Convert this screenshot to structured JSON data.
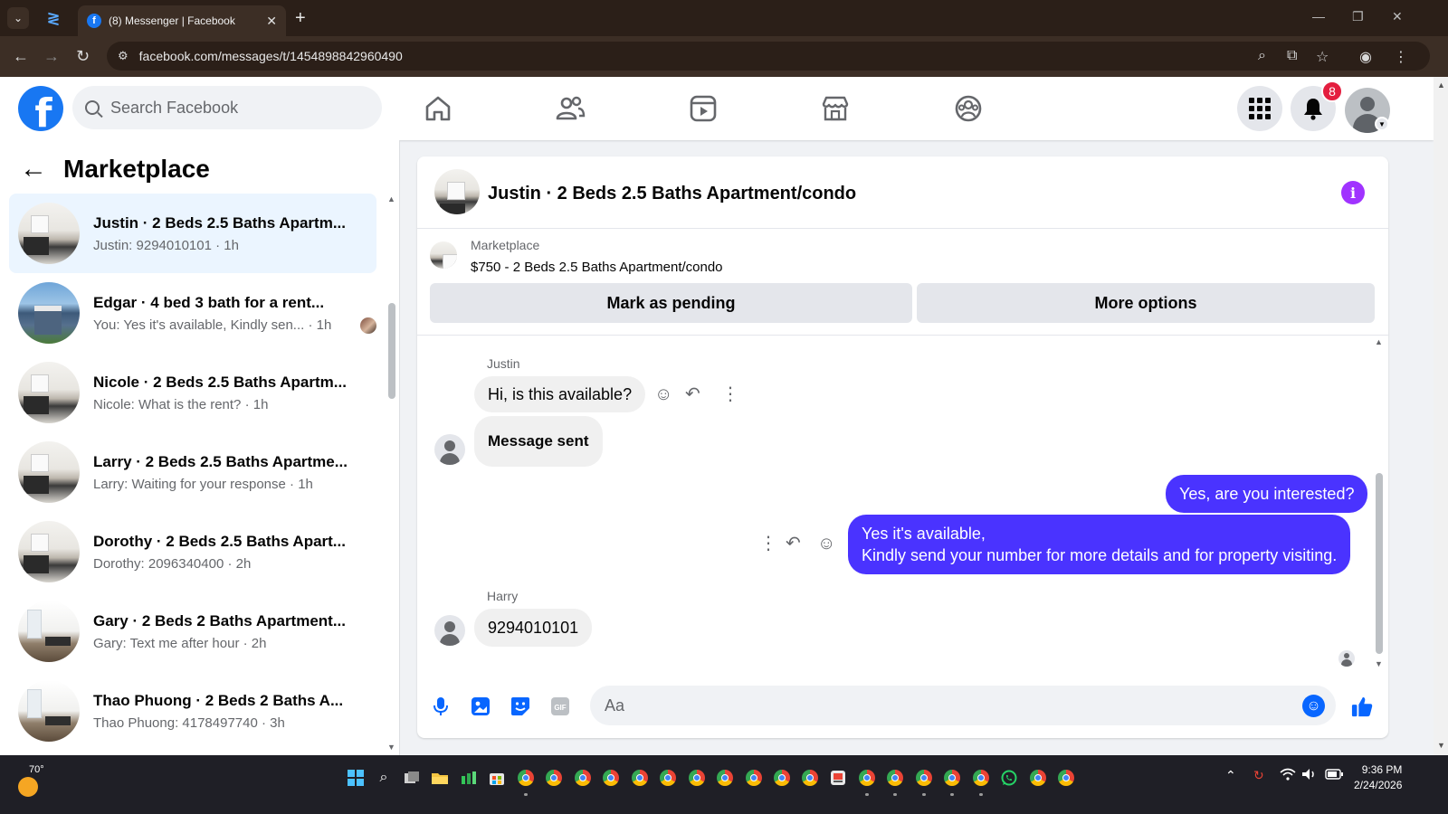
{
  "browser": {
    "tab_title": "(8) Messenger | Facebook",
    "url": "facebook.com/messages/t/1454898842960490"
  },
  "fb": {
    "search_placeholder": "Search Facebook",
    "notifications_count": "8"
  },
  "marketplace": {
    "title": "Marketplace",
    "conversations": [
      {
        "name": "Justin · 2 Beds 2.5 Baths Apartm...",
        "preview": "Justin: 9294010101 · 1h",
        "thumb": "room",
        "active": true
      },
      {
        "name": "Edgar · 4 bed 3 bath for a rent...",
        "preview": "You: Yes it's available, Kindly sen... · 1h",
        "thumb": "house",
        "active": false
      },
      {
        "name": "Nicole · 2 Beds 2.5 Baths Apartm...",
        "preview": "Nicole: What is the rent? · 1h",
        "thumb": "room",
        "active": false
      },
      {
        "name": "Larry · 2 Beds 2.5 Baths Apartme...",
        "preview": "Larry: Waiting for your response · 1h",
        "thumb": "room",
        "active": false
      },
      {
        "name": "Dorothy · 2 Beds 2.5 Baths Apart...",
        "preview": "Dorothy: 2096340400 · 2h",
        "thumb": "room",
        "active": false
      },
      {
        "name": "Gary · 2 Beds 2 Baths Apartment...",
        "preview": "Gary: Text me after hour · 2h",
        "thumb": "bright",
        "active": false
      },
      {
        "name": "Thao Phuong · 2 Beds 2 Baths A...",
        "preview": "Thao Phuong: 4178497740 · 3h",
        "thumb": "bright",
        "active": false
      }
    ]
  },
  "chat": {
    "title": "Justin · 2 Beds 2.5 Baths Apartment/condo",
    "listing_label": "Marketplace",
    "listing_price": "$750 - 2 Beds 2.5 Baths Apartment/condo",
    "btn_pending": "Mark as pending",
    "btn_more": "More options",
    "messages": {
      "sender1": "Justin",
      "m1": "Hi, is this available?",
      "m2": "Message sent",
      "m3": "Yes, are you interested?",
      "m4_line1": "Yes it's available,",
      "m4_line2": "Kindly send your number for more details and for property visiting.",
      "sender2": "Harry",
      "m5": "9294010101"
    },
    "composer_placeholder": "Aa",
    "gif_label": "GIF"
  },
  "taskbar": {
    "temperature": "70°",
    "time": "9:36 PM",
    "date": "2/24/2026"
  },
  "colors": {
    "fb_blue": "#1877f2",
    "outgoing_bubble": "#4a33ff",
    "info_purple": "#a033ff",
    "notification_red": "#e41e3f"
  }
}
